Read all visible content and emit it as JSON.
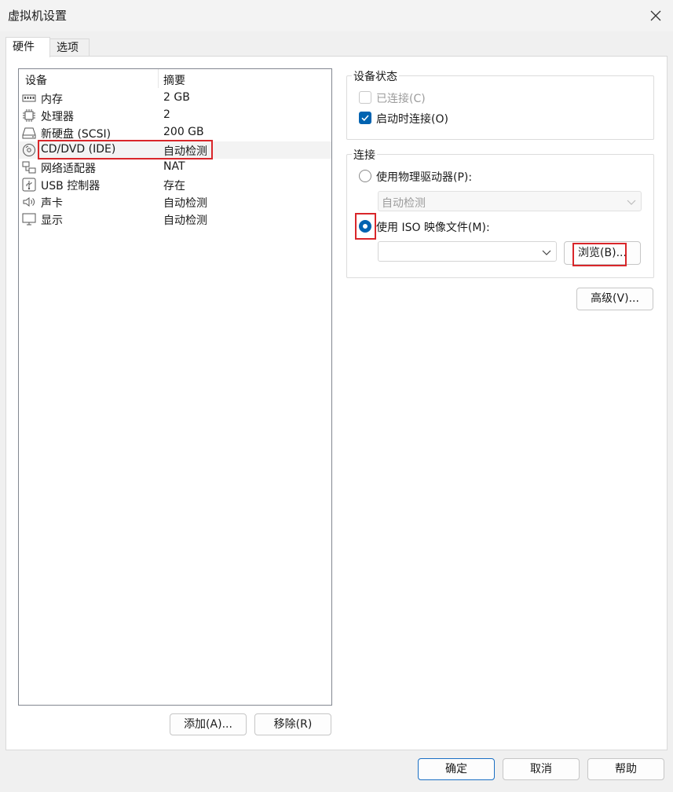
{
  "window": {
    "title": "虚拟机设置"
  },
  "tabs": [
    {
      "label": "硬件"
    },
    {
      "label": "选项"
    }
  ],
  "device_list": {
    "headers": {
      "device": "设备",
      "summary": "摘要"
    },
    "rows": [
      {
        "name": "内存",
        "summary": "2 GB",
        "icon": "memory-icon"
      },
      {
        "name": "处理器",
        "summary": "2",
        "icon": "processor-icon"
      },
      {
        "name": "新硬盘 (SCSI)",
        "summary": "200 GB",
        "icon": "hard-disk-icon"
      },
      {
        "name": "CD/DVD (IDE)",
        "summary": "自动检测",
        "icon": "cd-dvd-icon"
      },
      {
        "name": "网络适配器",
        "summary": "NAT",
        "icon": "network-adapter-icon"
      },
      {
        "name": "USB 控制器",
        "summary": "存在",
        "icon": "usb-icon"
      },
      {
        "name": "声卡",
        "summary": "自动检测",
        "icon": "speaker-icon"
      },
      {
        "name": "显示",
        "summary": "自动检测",
        "icon": "monitor-icon"
      }
    ],
    "selected_index": 3
  },
  "list_buttons": {
    "add": "添加(A)...",
    "remove": "移除(R)"
  },
  "device_status": {
    "title": "设备状态",
    "connected": {
      "label": "已连接(C)",
      "checked": false,
      "disabled": true
    },
    "connect_on_startup": {
      "label": "启动时连接(O)",
      "checked": true
    }
  },
  "connection": {
    "title": "连接",
    "physical_drive": {
      "label": "使用物理驱动器(P):",
      "selected": false
    },
    "physical_drive_select": {
      "value": "自动检测",
      "disabled": true
    },
    "iso_image": {
      "label": "使用 ISO 映像文件(M):",
      "selected": true
    },
    "iso_path": {
      "value": ""
    },
    "browse": "浏览(B)..."
  },
  "advanced_button": "高级(V)...",
  "footer": {
    "ok": "确定",
    "cancel": "取消",
    "help": "帮助"
  },
  "colors": {
    "accent": "#0063b1",
    "highlight": "#d9262a",
    "selected_row": "#f3f3f3"
  }
}
